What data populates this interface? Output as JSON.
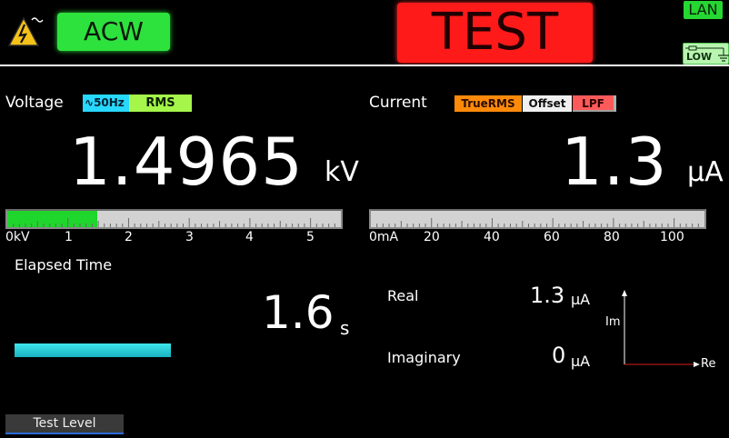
{
  "header": {
    "mode": "ACW",
    "status": "TEST",
    "lan": "LAN",
    "low": "LOW",
    "icons": [
      "high-voltage-warning-icon",
      "low-ground-icon"
    ],
    "colors": {
      "mode": "#2ee23e",
      "status": "#ff1a1a",
      "lan": "#26d632",
      "low": "#b8f5b0"
    }
  },
  "voltage": {
    "label": "Voltage",
    "freq_badge": "50Hz",
    "rms_badge": "RMS",
    "value": "1.4965",
    "unit": "kV",
    "meter": {
      "fill_fraction": 0.27,
      "color": "#1fd62c",
      "ticks": [
        "0kV",
        "1",
        "2",
        "3",
        "4",
        "5"
      ]
    }
  },
  "current": {
    "label": "Current",
    "badges": {
      "truerms": "TrueRMS",
      "offset": "Offset",
      "lpf": "LPF"
    },
    "value": "1.3",
    "unit": "µA",
    "meter": {
      "fill_fraction": 0.0,
      "ticks": [
        "0mA",
        "20",
        "40",
        "60",
        "80",
        "100"
      ]
    }
  },
  "elapsed": {
    "label": "Elapsed Time",
    "value": "1.6",
    "unit": "s",
    "progress_fraction": 0.22
  },
  "complex": {
    "real_label": "Real",
    "real_value": "1.3",
    "real_unit": "µA",
    "imag_label": "Imaginary",
    "imag_value": "0",
    "imag_unit": "µA",
    "axis_im": "Im",
    "axis_re": "Re"
  },
  "softkeys": {
    "test_level": "Test Level"
  }
}
